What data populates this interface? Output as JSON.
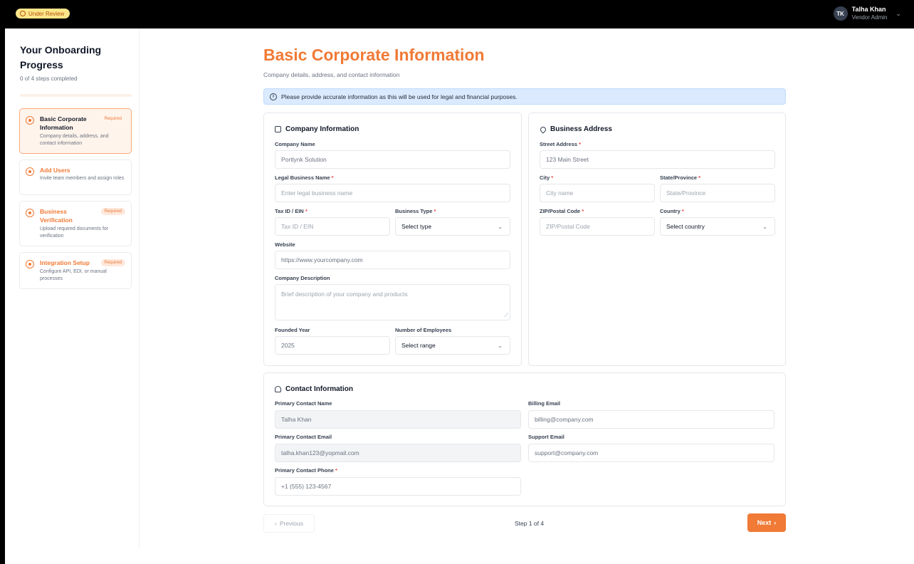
{
  "header": {
    "status": "Under Review",
    "user_initials": "TK",
    "user_name": "Talha Khan",
    "user_role": "Vendor Admin"
  },
  "sidebar": {
    "title": "Your Onboarding Progress",
    "subtitle": "0 of 4 steps completed",
    "progress": 0,
    "steps": [
      {
        "title": "Basic Corporate Information",
        "badge": "Required",
        "desc": "Company details, address, and contact information"
      },
      {
        "title": "Add Users",
        "badge": "",
        "desc": "Invite team members and assign roles"
      },
      {
        "title": "Business Verification",
        "badge": "Required",
        "desc": "Upload required documents for verification"
      },
      {
        "title": "Integration Setup",
        "badge": "Required",
        "desc": "Configure API, EDI, or manual processes"
      }
    ]
  },
  "main": {
    "title": "Basic Corporate Information",
    "subtitle": "Company details, address, and contact information",
    "notice": "Please provide accurate information as this will be used for legal and financial purposes."
  },
  "company": {
    "title": "Company Information",
    "name_label": "Company Name",
    "name_value": "Portlynk Solution",
    "legal_label": "Legal Business Name",
    "legal_placeholder": "Enter legal business name",
    "tax_label": "Tax ID / EIN",
    "tax_placeholder": "Tax ID / EIN",
    "type_label": "Business Type",
    "type_value": "Select type",
    "website_label": "Website",
    "website_placeholder": "https://www.yourcompany.com",
    "desc_label": "Company Description",
    "desc_placeholder": "Brief description of your company and products",
    "founded_label": "Founded Year",
    "founded_value": "2025",
    "employees_label": "Number of Employees",
    "employees_value": "Select range"
  },
  "address": {
    "title": "Business Address",
    "street_label": "Street Address",
    "street_placeholder": "123 Main Street",
    "city_label": "City",
    "city_placeholder": "City name",
    "state_label": "State/Province",
    "state_placeholder": "State/Province",
    "zip_label": "ZIP/Postal Code",
    "zip_placeholder": "ZIP/Postal Code",
    "country_label": "Country",
    "country_value": "Select country"
  },
  "contact": {
    "title": "Contact Information",
    "name_label": "Primary Contact Name",
    "name_value": "Talha Khan",
    "email_label": "Primary Contact Email",
    "email_value": "talha.khan123@yopmail.com",
    "phone_label": "Primary Contact Phone",
    "phone_placeholder": "+1 (555) 123-4567",
    "billing_label": "Billing Email",
    "billing_placeholder": "billing@company.com",
    "support_label": "Support Email",
    "support_placeholder": "support@company.com"
  },
  "footer": {
    "previous": "Previous",
    "step": "Step 1 of 4",
    "next": "Next"
  },
  "colors": {
    "accent": "#f07a36",
    "notice_bg": "#dbeafe"
  }
}
